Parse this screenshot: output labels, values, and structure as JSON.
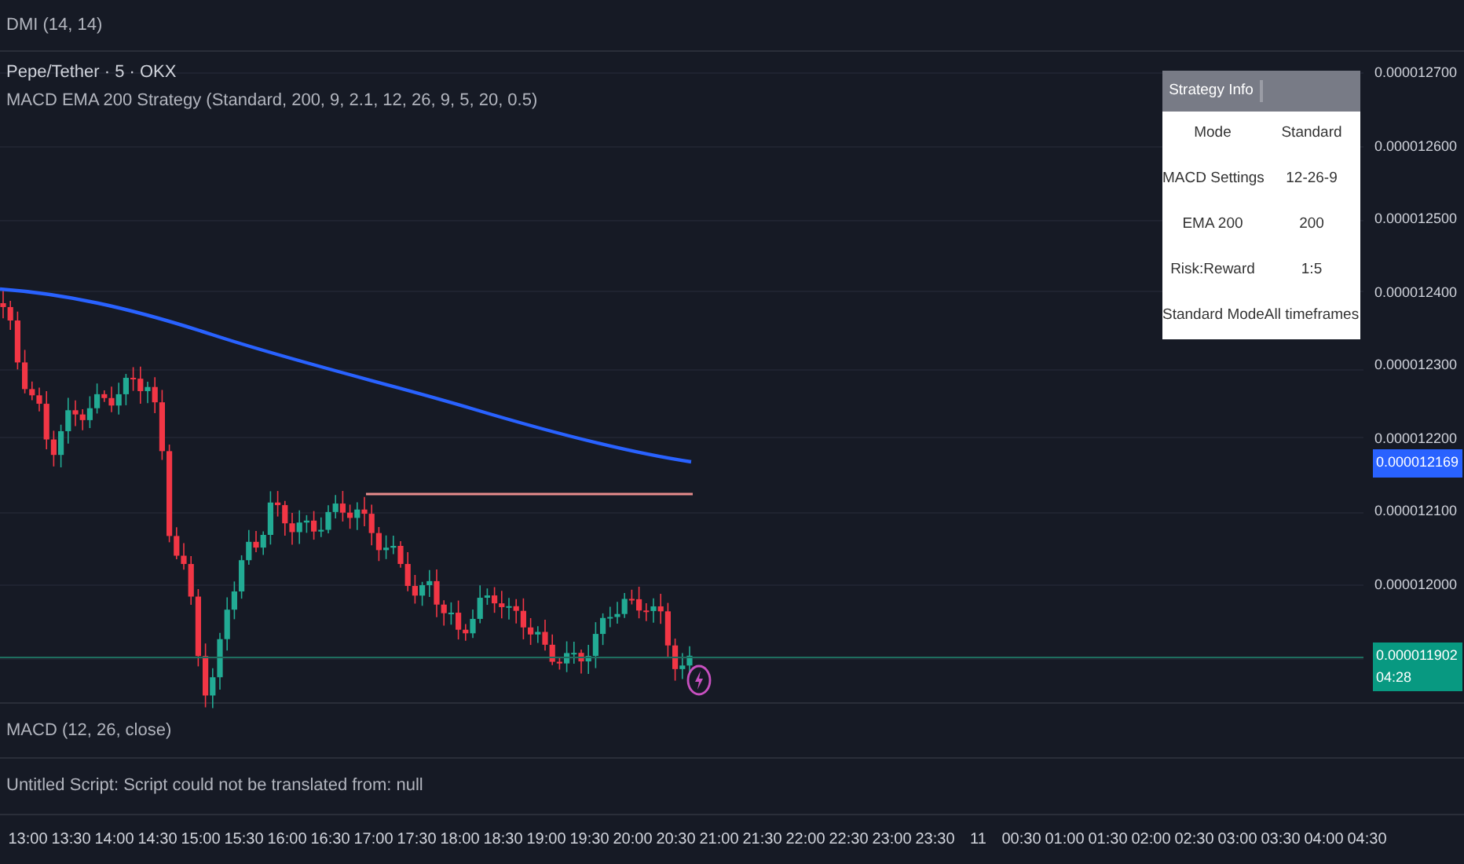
{
  "top_pane": {
    "label": "DMI (14, 14)"
  },
  "main_pane": {
    "symbol": "Pepe/Tether · 5 · OKX",
    "strategy": "MACD EMA 200 Strategy (Standard, 200, 9, 2.1, 12, 26, 9, 5, 20, 0.5)"
  },
  "strategy_table": {
    "header": "Strategy Info",
    "rows": [
      {
        "label": "Mode",
        "value": "Standard"
      },
      {
        "label": "MACD Settings",
        "value": "12-26-9"
      },
      {
        "label": "EMA 200",
        "value": "200"
      },
      {
        "label": "Risk:Reward",
        "value": "1:5"
      },
      {
        "label": "Standard Mode",
        "value": "All timeframes"
      }
    ]
  },
  "price_axis": {
    "ticks": [
      "0.000012700",
      "0.000012600",
      "0.000012500",
      "0.000012400",
      "0.000012300",
      "0.000012200",
      "0.000012100",
      "0.000012000"
    ],
    "ema_badge": "0.000012169",
    "last_price": "0.000011902",
    "countdown": "04:28"
  },
  "macd_pane": {
    "label": "MACD (12, 26, close)"
  },
  "script_pane": {
    "message": "Untitled Script: Script could not be translated from: null"
  },
  "time_axis": {
    "labels": [
      "13:00",
      "13:30",
      "14:00",
      "14:30",
      "15:00",
      "15:30",
      "16:00",
      "16:30",
      "17:00",
      "17:30",
      "18:00",
      "18:30",
      "19:00",
      "19:30",
      "20:00",
      "20:30",
      "21:00",
      "21:30",
      "22:00",
      "22:30",
      "23:00",
      "23:30",
      "11",
      "00:30",
      "01:00",
      "01:30",
      "02:00",
      "02:30",
      "03:00",
      "03:30",
      "04:00",
      "04:30"
    ]
  }
}
